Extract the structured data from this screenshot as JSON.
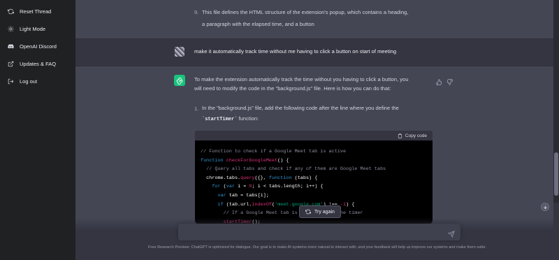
{
  "sidebar": {
    "items": [
      {
        "label": "Reset Thread",
        "icon": "refresh-icon"
      },
      {
        "label": "Light Mode",
        "icon": "sun-icon"
      },
      {
        "label": "OpenAI Discord",
        "icon": "discord-icon"
      },
      {
        "label": "Updates & FAQ",
        "icon": "external-link-icon"
      },
      {
        "label": "Log out",
        "icon": "logout-icon"
      }
    ]
  },
  "thread": {
    "prev_item_number": "9.",
    "prev_item_line1": "This file defines the HTML structure of the extension's popup, which contains a heading,",
    "prev_item_line2": "a paragraph with the elapsed time, and a button",
    "user_message": "make it automatically track time without me having to click a button on start of meeting",
    "ai_intro_line1": "To make the extension automatically track the time without you having to click a button, you",
    "ai_intro_line2": "will need to modify the code in the \"background.js\" file. Here is how you can do that:",
    "step_number": "1.",
    "step_line1": "In the \"background.js\" file, add the following code after the line where you define the",
    "step_code": "`startTimer`",
    "step_line2_suffix": " function:"
  },
  "code_block": {
    "copy_label": "Copy code",
    "lines": [
      [
        {
          "t": "// Function to check if a Google Meet tab is active",
          "c": "com"
        }
      ],
      [
        {
          "t": "function ",
          "c": "kw"
        },
        {
          "t": "checkForGoogleMeet",
          "c": "fn"
        },
        {
          "t": "() {",
          "c": ""
        }
      ],
      [
        {
          "t": "  // Query all tabs and check if any of them are Google Meet tabs",
          "c": "com"
        }
      ],
      [
        {
          "t": "  chrome.tabs.",
          "c": ""
        },
        {
          "t": "query",
          "c": "fn"
        },
        {
          "t": "({}, ",
          "c": ""
        },
        {
          "t": "function",
          "c": "kw"
        },
        {
          "t": " (tabs) {",
          "c": ""
        }
      ],
      [
        {
          "t": "    ",
          "c": ""
        },
        {
          "t": "for",
          "c": "kw"
        },
        {
          "t": " (",
          "c": ""
        },
        {
          "t": "var",
          "c": "kw"
        },
        {
          "t": " i = ",
          "c": ""
        },
        {
          "t": "0",
          "c": "num"
        },
        {
          "t": "; i < tabs.length; i++) {",
          "c": ""
        }
      ],
      [
        {
          "t": "      ",
          "c": ""
        },
        {
          "t": "var",
          "c": "kw"
        },
        {
          "t": " tab = tabs[i];",
          "c": ""
        }
      ],
      [
        {
          "t": "      ",
          "c": ""
        },
        {
          "t": "if",
          "c": "kw"
        },
        {
          "t": " (tab.url.",
          "c": ""
        },
        {
          "t": "indexOf",
          "c": "fn"
        },
        {
          "t": "(",
          "c": ""
        },
        {
          "t": "'meet.google.com'",
          "c": "str"
        },
        {
          "t": ") !== ",
          "c": ""
        },
        {
          "t": "-1",
          "c": "num"
        },
        {
          "t": ") {",
          "c": ""
        }
      ],
      [
        {
          "t": "        // If a Google Meet tab is found, start the timer",
          "c": "com"
        }
      ],
      [
        {
          "t": "        ",
          "c": ""
        },
        {
          "t": "startTimer",
          "c": "fn"
        },
        {
          "t": "();",
          "c": ""
        }
      ]
    ]
  },
  "try_again_label": "Try again",
  "composer": {
    "placeholder": "",
    "value": ""
  },
  "footer_text": "Free Research Preview: ChatGPT is optimized for dialogue. Our goal is to make AI systems more natural to interact with, and your feedback will help us improve our systems and make them safer."
}
